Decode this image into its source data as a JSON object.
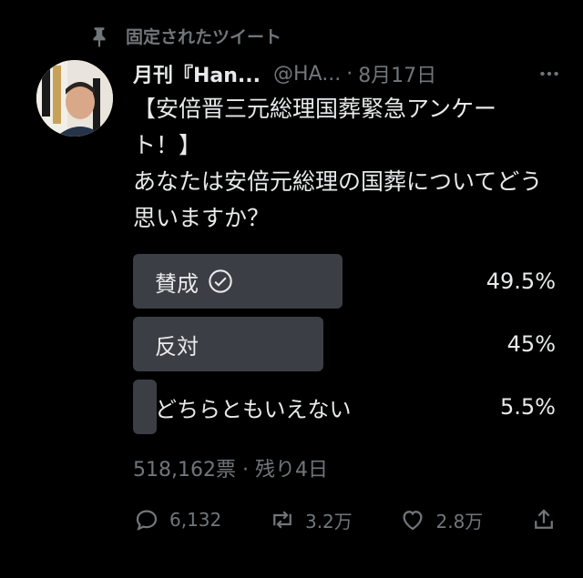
{
  "pinned": {
    "label": "固定されたツイート",
    "icon": "pin-icon"
  },
  "author": {
    "name": "月刊『Han...",
    "handle": "@HA...",
    "separator": "·",
    "date": "8月17日",
    "avatar_icon": "avatar"
  },
  "tweet": {
    "text": "【安倍晋三元総理国葬緊急アンケート！】\nあなたは安倍元総理の国葬についてどう思いますか？"
  },
  "poll": {
    "options": [
      {
        "label": "賛成",
        "percent_text": "49.5%",
        "percent": 49.5,
        "selected": true
      },
      {
        "label": "反対",
        "percent_text": "45%",
        "percent": 45,
        "selected": false
      },
      {
        "label": "どちらともいえない",
        "percent_text": "5.5%",
        "percent": 5.5,
        "selected": false
      }
    ],
    "meta": "518,162票 · 残り4日"
  },
  "actions": {
    "reply_count": "6,132",
    "retweet_count": "3.2万",
    "like_count": "2.8万"
  },
  "colors": {
    "background": "#000000",
    "text": "#e7e9ea",
    "muted": "#71767b",
    "bar": "#3b3e44"
  }
}
